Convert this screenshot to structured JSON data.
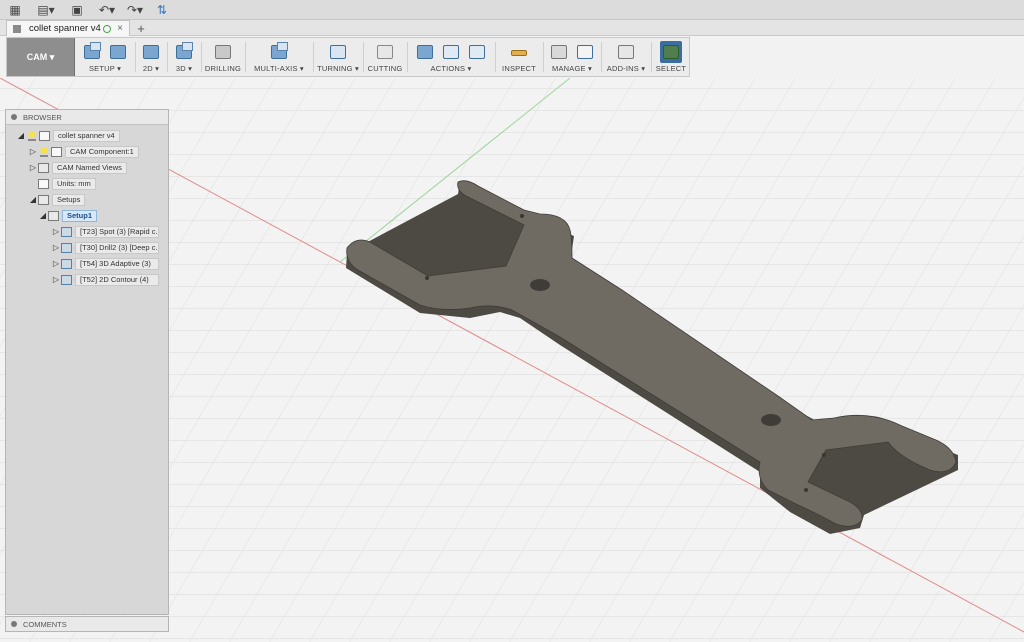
{
  "document": {
    "tab_title": "collet spanner v4",
    "new_tab": "+"
  },
  "workspace": {
    "label": "CAM ▾"
  },
  "ribbon": {
    "groups": [
      {
        "label": "SETUP ▾"
      },
      {
        "label": "2D ▾"
      },
      {
        "label": "3D ▾"
      },
      {
        "label": "DRILLING"
      },
      {
        "label": "MULTI-AXIS ▾"
      },
      {
        "label": "TURNING ▾"
      },
      {
        "label": "CUTTING"
      },
      {
        "label": "ACTIONS ▾"
      },
      {
        "label": "INSPECT"
      },
      {
        "label": "MANAGE ▾"
      },
      {
        "label": "ADD-INS ▾"
      },
      {
        "label": "SELECT"
      }
    ]
  },
  "browser": {
    "title": "BROWSER",
    "root": "collet spanner v4",
    "component": "CAM Component:1",
    "named_views": "CAM Named Views",
    "units": "Units: mm",
    "setups": "Setups",
    "setup1": "Setup1",
    "operations": [
      "[T23] Spot (3) [Rapid c...",
      "[T30] Drill2 (3) [Deep c...",
      "[T54] 3D Adaptive (3)",
      "[T52] 2D Contour (4)"
    ]
  },
  "comments": {
    "title": "COMMENTS"
  },
  "icons": {
    "app_grid": "app-grid-icon",
    "file": "file-icon",
    "save": "save-icon",
    "undo": "undo-icon",
    "redo": "redo-icon",
    "job_status": "job-status-icon"
  },
  "colors": {
    "part_top": "#6f6a62",
    "part_side": "#4d4943",
    "grid": "#d9d9d9",
    "axis_red": "#e08b8b",
    "axis_green": "#9ed49e"
  }
}
